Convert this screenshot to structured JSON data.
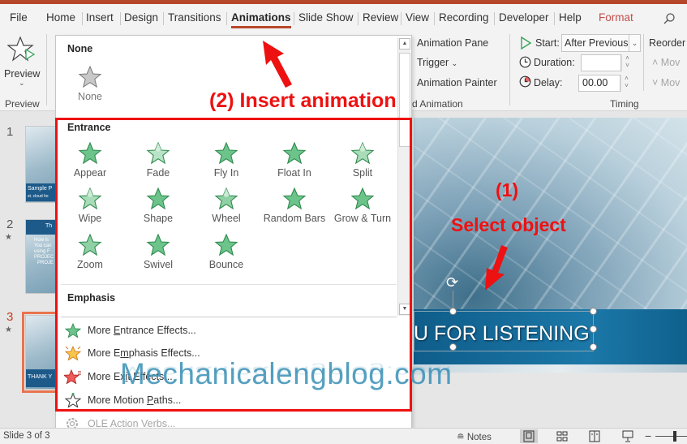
{
  "ribbon_tabs": [
    {
      "label": "File"
    },
    {
      "label": "Home"
    },
    {
      "label": "Insert"
    },
    {
      "label": "Design"
    },
    {
      "label": "Transitions"
    },
    {
      "label": "Animations"
    },
    {
      "label": "Slide Show"
    },
    {
      "label": "Review"
    },
    {
      "label": "View"
    },
    {
      "label": "Recording"
    },
    {
      "label": "Developer"
    },
    {
      "label": "Help"
    },
    {
      "label": "Format"
    }
  ],
  "active_tab": "Animations",
  "ribbon": {
    "preview": {
      "button_label": "Preview",
      "group_label": "Preview"
    },
    "advanced": {
      "animation_pane": "Animation Pane",
      "trigger": "Trigger",
      "animation_painter": "Animation Painter",
      "group_label": "d Animation"
    },
    "timing": {
      "start_label": "Start:",
      "start_value": "After Previous",
      "duration_label": "Duration:",
      "duration_value": "",
      "delay_label": "Delay:",
      "delay_value": "00.00",
      "group_label": "Timing"
    },
    "reorder": {
      "header": "Reorder A",
      "move_earlier": "Mov",
      "move_later": "Mov"
    }
  },
  "gallery": {
    "none_section": {
      "header": "None",
      "item": "None"
    },
    "entrance_section": {
      "header": "Entrance",
      "items": [
        "Appear",
        "Fade",
        "Fly In",
        "Float In",
        "Split",
        "Wipe",
        "Shape",
        "Wheel",
        "Random Bars",
        "Grow & Turn",
        "Zoom",
        "Swivel",
        "Bounce"
      ]
    },
    "emphasis_section": {
      "header": "Emphasis"
    },
    "more_items": [
      {
        "pre": "More ",
        "key": "E",
        "post": "ntrance Effects...",
        "icon": "entrance-star-icon"
      },
      {
        "pre": "More E",
        "key": "m",
        "post": "phasis Effects...",
        "icon": "emphasis-star-icon"
      },
      {
        "pre": "More Ex",
        "key": "i",
        "post": "t Effects...",
        "icon": "exit-star-icon"
      },
      {
        "pre": "More Motion ",
        "key": "P",
        "post": "aths...",
        "icon": "motion-path-star-icon"
      }
    ],
    "ole_action_verbs": {
      "key": "O",
      "post": "LE Action Verbs..."
    }
  },
  "slides_panel": {
    "slides": [
      {
        "number": "1",
        "has_animation": false,
        "thumb_text": [
          "Sample P",
          "st. cloud ho"
        ]
      },
      {
        "number": "2",
        "has_animation": true,
        "thumb_text": [
          "Th",
          "How is",
          "You can",
          "using F",
          "PROJEC",
          "PROJE"
        ]
      },
      {
        "number": "3",
        "has_animation": true,
        "selected": true,
        "thumb_text": [
          "THANK Y"
        ]
      }
    ]
  },
  "slide": {
    "title_text": "U FOR LISTENING"
  },
  "annotations": {
    "step1_number": "(1)",
    "step1_text": "Select object",
    "step2_text": "(2) Insert animation"
  },
  "watermark": "Mechanicalengblog.com",
  "status_bar": {
    "slide_counter": "Slide 3 of 3",
    "notes_label": "Notes"
  },
  "colors": {
    "accent": "#b7472a",
    "format_tab": "#c0504d",
    "annotation_red": "#ee1111",
    "entrance_green": "#6cc48a"
  }
}
